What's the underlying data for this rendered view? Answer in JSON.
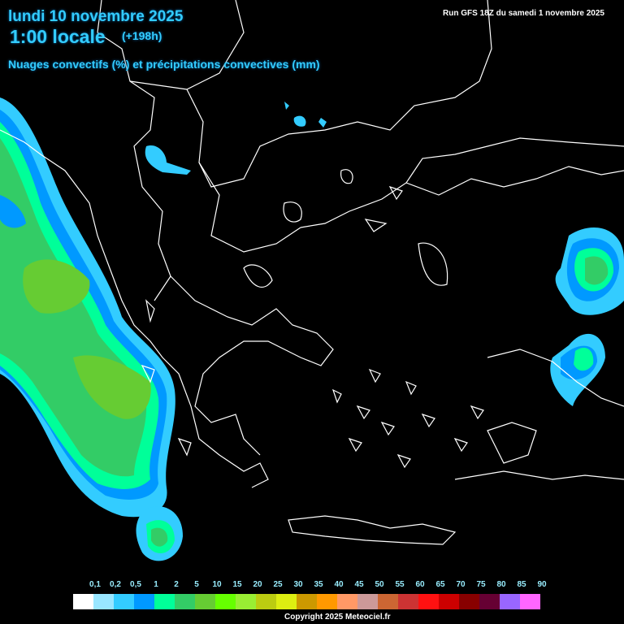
{
  "header": {
    "date": "lundi 10 novembre 2025",
    "time": "1:00 locale",
    "lead": "(+198h)",
    "parameter": "Nuages convectifs (%) et précipitations convectives (mm)",
    "run": "Run GFS 18Z du samedi 1 novembre 2025"
  },
  "legend": {
    "labels": [
      "0,1",
      "0,2",
      "0,5",
      "1",
      "2",
      "5",
      "10",
      "15",
      "20",
      "25",
      "30",
      "35",
      "40",
      "45",
      "50",
      "55",
      "60",
      "65",
      "70",
      "75",
      "80",
      "85",
      "90"
    ],
    "colors": [
      "#ffffff",
      "#99e6ff",
      "#33ccff",
      "#0099ff",
      "#00ff99",
      "#33cc66",
      "#66cc33",
      "#66ff00",
      "#99ee33",
      "#bbcc11",
      "#ddee11",
      "#cc9900",
      "#ff9900",
      "#ff9966",
      "#cc9999",
      "#cc6633",
      "#cc3333",
      "#ff1111",
      "#cc0000",
      "#880000",
      "#660033",
      "#9966ff",
      "#ff66ff"
    ]
  },
  "footer": {
    "copyright": "Copyright 2025 Meteociel.fr"
  }
}
